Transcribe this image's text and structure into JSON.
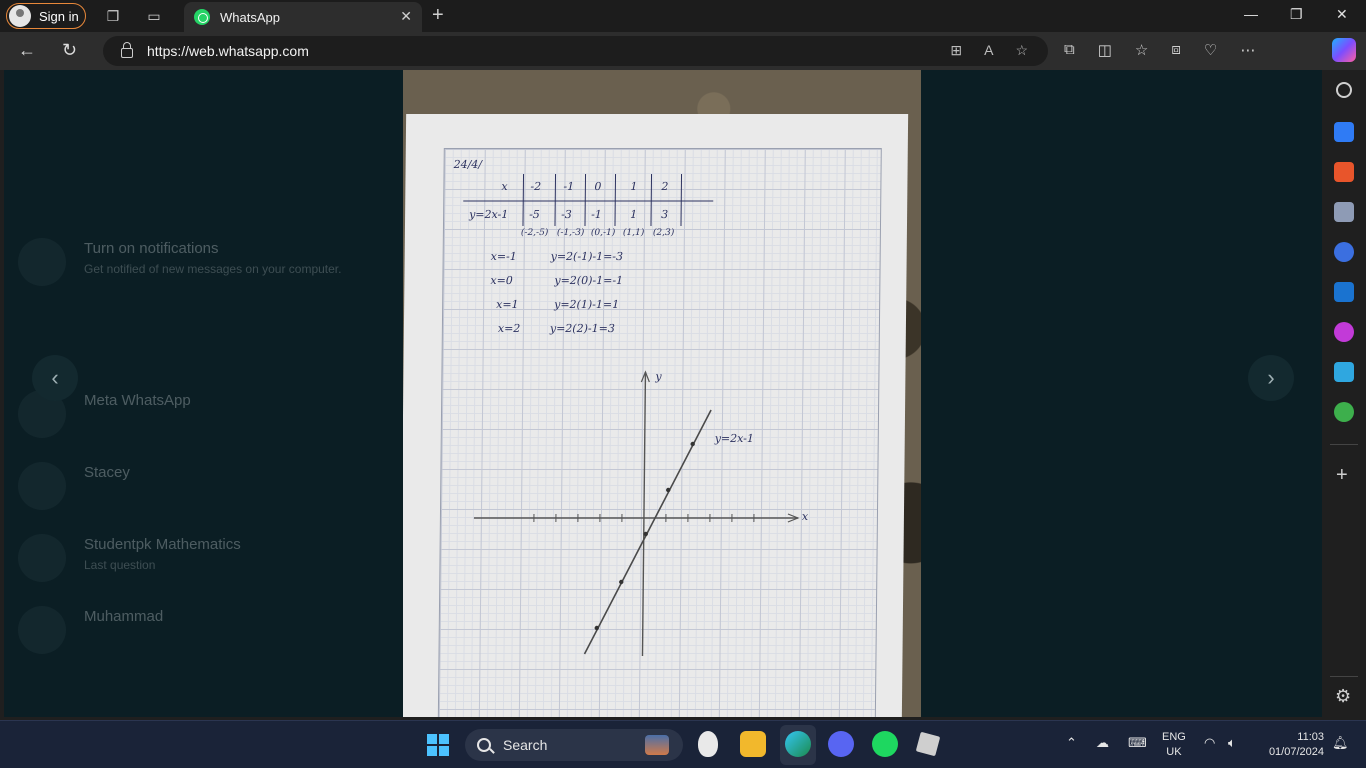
{
  "browser": {
    "sign_in_label": "Sign in",
    "tab_title": "WhatsApp",
    "url": "https://web.whatsapp.com"
  },
  "background_list": {
    "items": [
      {
        "title": "Turn on notifications",
        "sub": "Get notified of new messages on your computer."
      },
      {
        "title": "Meta WhatsApp",
        "sub": ""
      },
      {
        "title": "Stacey",
        "sub": ""
      },
      {
        "title": "Studentpk Mathematics",
        "sub": "Last question"
      },
      {
        "title": "Muhammad",
        "sub": ""
      }
    ]
  },
  "viewer": {
    "prev_icon": "chevron-left-icon",
    "next_icon": "chevron-right-icon"
  },
  "worksheet": {
    "date": "24/4/",
    "table_row_x_label": "x",
    "table_row_y_label": "y=2x-1",
    "x_values": [
      "-2",
      "-1",
      "0",
      "1",
      "2"
    ],
    "y_values": [
      "-5",
      "-3",
      "-1",
      "1",
      "3"
    ],
    "points": [
      "(-2,-5)",
      "(-1,-3)",
      "(0,-1)",
      "(1,1)",
      "(2,3)"
    ],
    "steps": [
      {
        "x": "x=-1",
        "y": "y=2(-1)-1=-3"
      },
      {
        "x": "x=0",
        "y": "y=2(0)-1=-1"
      },
      {
        "x": "x=1",
        "y": "y=2(1)-1=1"
      },
      {
        "x": "x=2",
        "y": "y=2(2)-1=3"
      }
    ],
    "line_label": "y=2x-1",
    "x_axis_label": "x",
    "y_axis_label": "y"
  },
  "taskbar": {
    "search_label": "Search",
    "lang_top": "ENG",
    "lang_bottom": "UK",
    "time": "11:03",
    "date": "01/07/2024"
  }
}
